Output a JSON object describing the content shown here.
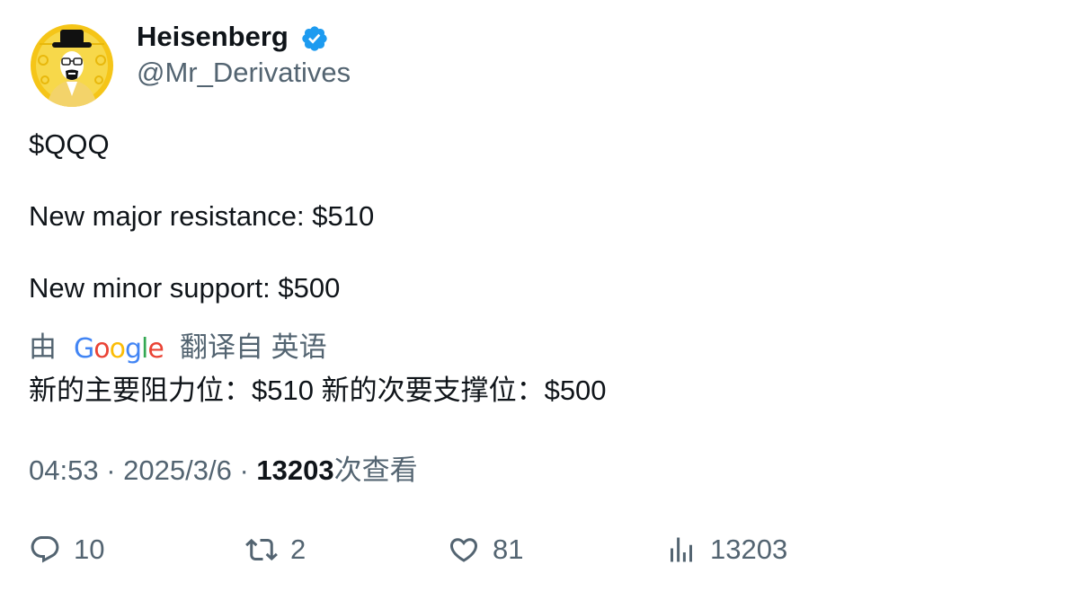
{
  "author": {
    "display_name": "Heisenberg",
    "handle": "@Mr_Derivatives",
    "verified": true,
    "verified_color": "#1d9bf0"
  },
  "tweet": {
    "lines": [
      "$QQQ",
      "New major resistance: $510",
      "New minor support: $500"
    ]
  },
  "translation": {
    "by_label": "由",
    "provider": "Google",
    "link_label": "翻译自 英语",
    "text": "新的主要阻力位：$510 新的次要支撑位：$500"
  },
  "meta": {
    "time": "04:53",
    "separator": "·",
    "date": "2025/3/6",
    "views_count": "13203",
    "views_label": "次查看"
  },
  "actions": {
    "replies": "10",
    "retweets": "2",
    "likes": "81",
    "views": "13203"
  },
  "icons": {
    "reply": "reply-icon",
    "retweet": "retweet-icon",
    "like": "heart-icon",
    "views": "bar-chart-icon",
    "verified": "verified-badge-icon"
  }
}
